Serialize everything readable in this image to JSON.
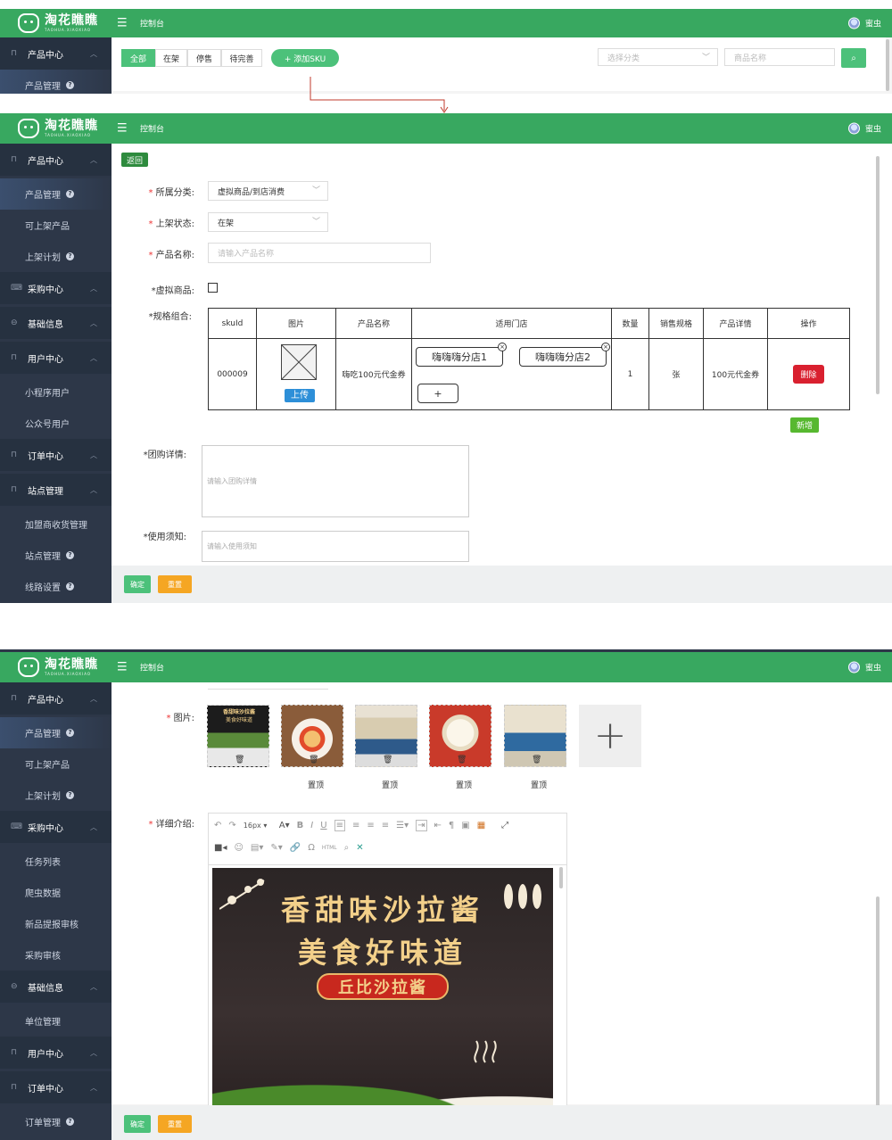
{
  "app": {
    "logo_text": "淘花瞧瞧",
    "logo_sub": "TAOHUA.XIAOXIAO",
    "breadcrumb": "控制台",
    "user_name": "蜜虫"
  },
  "screen1": {
    "sidebar": {
      "group": "产品中心",
      "item": "产品管理"
    },
    "tabs": [
      "全部",
      "在架",
      "停售",
      "待完善"
    ],
    "add_sku": "+ 添加SKU",
    "category_placeholder": "选择分类",
    "name_placeholder": "商品名称"
  },
  "screen2": {
    "sidebar": [
      {
        "type": "group",
        "label": "产品中心",
        "icon": "bookmark-icon"
      },
      {
        "type": "item",
        "label": "产品管理",
        "help": true,
        "active": true
      },
      {
        "type": "item",
        "label": "可上架产品"
      },
      {
        "type": "item",
        "label": "上架计划",
        "help": true
      },
      {
        "type": "group",
        "label": "采购中心",
        "icon": "keyboard-icon"
      },
      {
        "type": "group",
        "label": "基础信息",
        "icon": "lock-icon"
      },
      {
        "type": "group",
        "label": "用户中心",
        "icon": "bookmark-icon"
      },
      {
        "type": "item",
        "label": "小程序用户"
      },
      {
        "type": "item",
        "label": "公众号用户"
      },
      {
        "type": "group",
        "label": "订单中心",
        "icon": "bookmark-icon"
      },
      {
        "type": "group",
        "label": "站点管理",
        "icon": "bookmark-icon"
      },
      {
        "type": "item",
        "label": "加盟商收货管理"
      },
      {
        "type": "item",
        "label": "站点管理",
        "help": true
      },
      {
        "type": "item",
        "label": "线路设置",
        "help": true
      }
    ],
    "back": "返回",
    "form": {
      "category_label": "所属分类:",
      "category_value": "虚拟商品/到店消费",
      "status_label": "上架状态:",
      "status_value": "在架",
      "name_label": "产品名称:",
      "name_placeholder": "请输入产品名称",
      "virtual_label": "*虚拟商品:",
      "sku_label": "*规格组合:",
      "group_detail_label": "*团购详情:",
      "group_detail_placeholder": "请输入团购详情",
      "notice_label": "*使用须知:",
      "notice_placeholder": "请输入使用须知"
    },
    "table": {
      "headers": [
        "skuId",
        "图片",
        "产品名称",
        "适用门店",
        "数量",
        "销售规格",
        "产品详情",
        "操作"
      ],
      "row": {
        "skuid": "000009",
        "upload": "上传",
        "name": "嗨吃100元代金券",
        "stores": [
          "嗨嗨嗨分店1",
          "嗨嗨嗨分店2"
        ],
        "add_store": "+",
        "qty": "1",
        "spec": "张",
        "detail": "100元代金券",
        "delete": "删除"
      },
      "add": "新增"
    },
    "confirm": "确定",
    "reset": "重置"
  },
  "screen3": {
    "sidebar": [
      {
        "type": "group",
        "label": "产品中心",
        "icon": "bookmark-icon"
      },
      {
        "type": "item",
        "label": "产品管理",
        "help": true,
        "active": true
      },
      {
        "type": "item",
        "label": "可上架产品"
      },
      {
        "type": "item",
        "label": "上架计划",
        "help": true
      },
      {
        "type": "group",
        "label": "采购中心",
        "icon": "keyboard-icon"
      },
      {
        "type": "item",
        "label": "任务列表"
      },
      {
        "type": "item",
        "label": "爬虫数据"
      },
      {
        "type": "item",
        "label": "新品提报审核"
      },
      {
        "type": "item",
        "label": "采购审核"
      },
      {
        "type": "group",
        "label": "基础信息",
        "icon": "lock-icon"
      },
      {
        "type": "item",
        "label": "单位管理"
      },
      {
        "type": "group",
        "label": "用户中心",
        "icon": "bookmark-icon"
      },
      {
        "type": "group",
        "label": "订单中心",
        "icon": "bookmark-icon"
      },
      {
        "type": "item",
        "label": "订单管理",
        "help": true
      }
    ],
    "images_label": "图片:",
    "thumb_caption_1": "香甜味沙拉酱",
    "thumb_caption_2": "美食好味道",
    "top_label": "置顶",
    "detail_label": "详细介绍:",
    "toolbar_fontsize": "16px",
    "poster": {
      "line1": "香甜味沙拉酱",
      "line2": "美食好味道",
      "banner": "丘比沙拉酱"
    },
    "confirm": "确定",
    "reset": "重置"
  }
}
